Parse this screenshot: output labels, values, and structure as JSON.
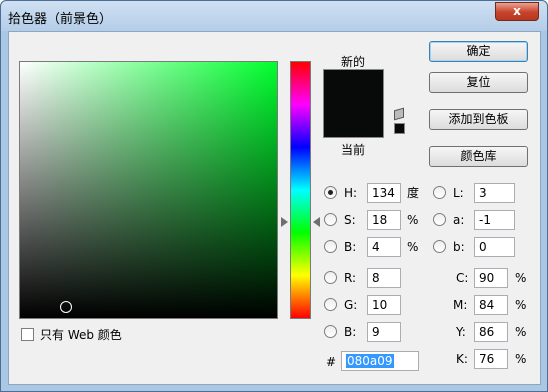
{
  "window": {
    "title": "拾色器（前景色）",
    "close_label": "x"
  },
  "colors": {
    "new": "#080a09",
    "current": "#080a09",
    "accent": "#3399ff"
  },
  "swatches": {
    "new_label": "新的",
    "current_label": "当前"
  },
  "buttons": {
    "ok": "确定",
    "reset": "复位",
    "add_to_swatches": "添加到色板",
    "color_libraries": "颜色库"
  },
  "hsb": {
    "h": {
      "label": "H:",
      "value": "134",
      "unit": "度",
      "selected": true
    },
    "s": {
      "label": "S:",
      "value": "18",
      "unit": "%"
    },
    "b": {
      "label": "B:",
      "value": "4",
      "unit": "%"
    }
  },
  "lab": {
    "l": {
      "label": "L:",
      "value": "3"
    },
    "a": {
      "label": "a:",
      "value": "-1"
    },
    "b": {
      "label": "b:",
      "value": "0"
    }
  },
  "rgb": {
    "r": {
      "label": "R:",
      "value": "8"
    },
    "g": {
      "label": "G:",
      "value": "10"
    },
    "b": {
      "label": "B:",
      "value": "9"
    }
  },
  "cmyk": {
    "c": {
      "label": "C:",
      "value": "90",
      "unit": "%"
    },
    "m": {
      "label": "M:",
      "value": "84",
      "unit": "%"
    },
    "y": {
      "label": "Y:",
      "value": "86",
      "unit": "%"
    },
    "k": {
      "label": "K:",
      "value": "76",
      "unit": "%"
    }
  },
  "hex": {
    "label": "#",
    "value": "080a09"
  },
  "web_only": {
    "label": "只有 Web 颜色",
    "checked": false
  }
}
